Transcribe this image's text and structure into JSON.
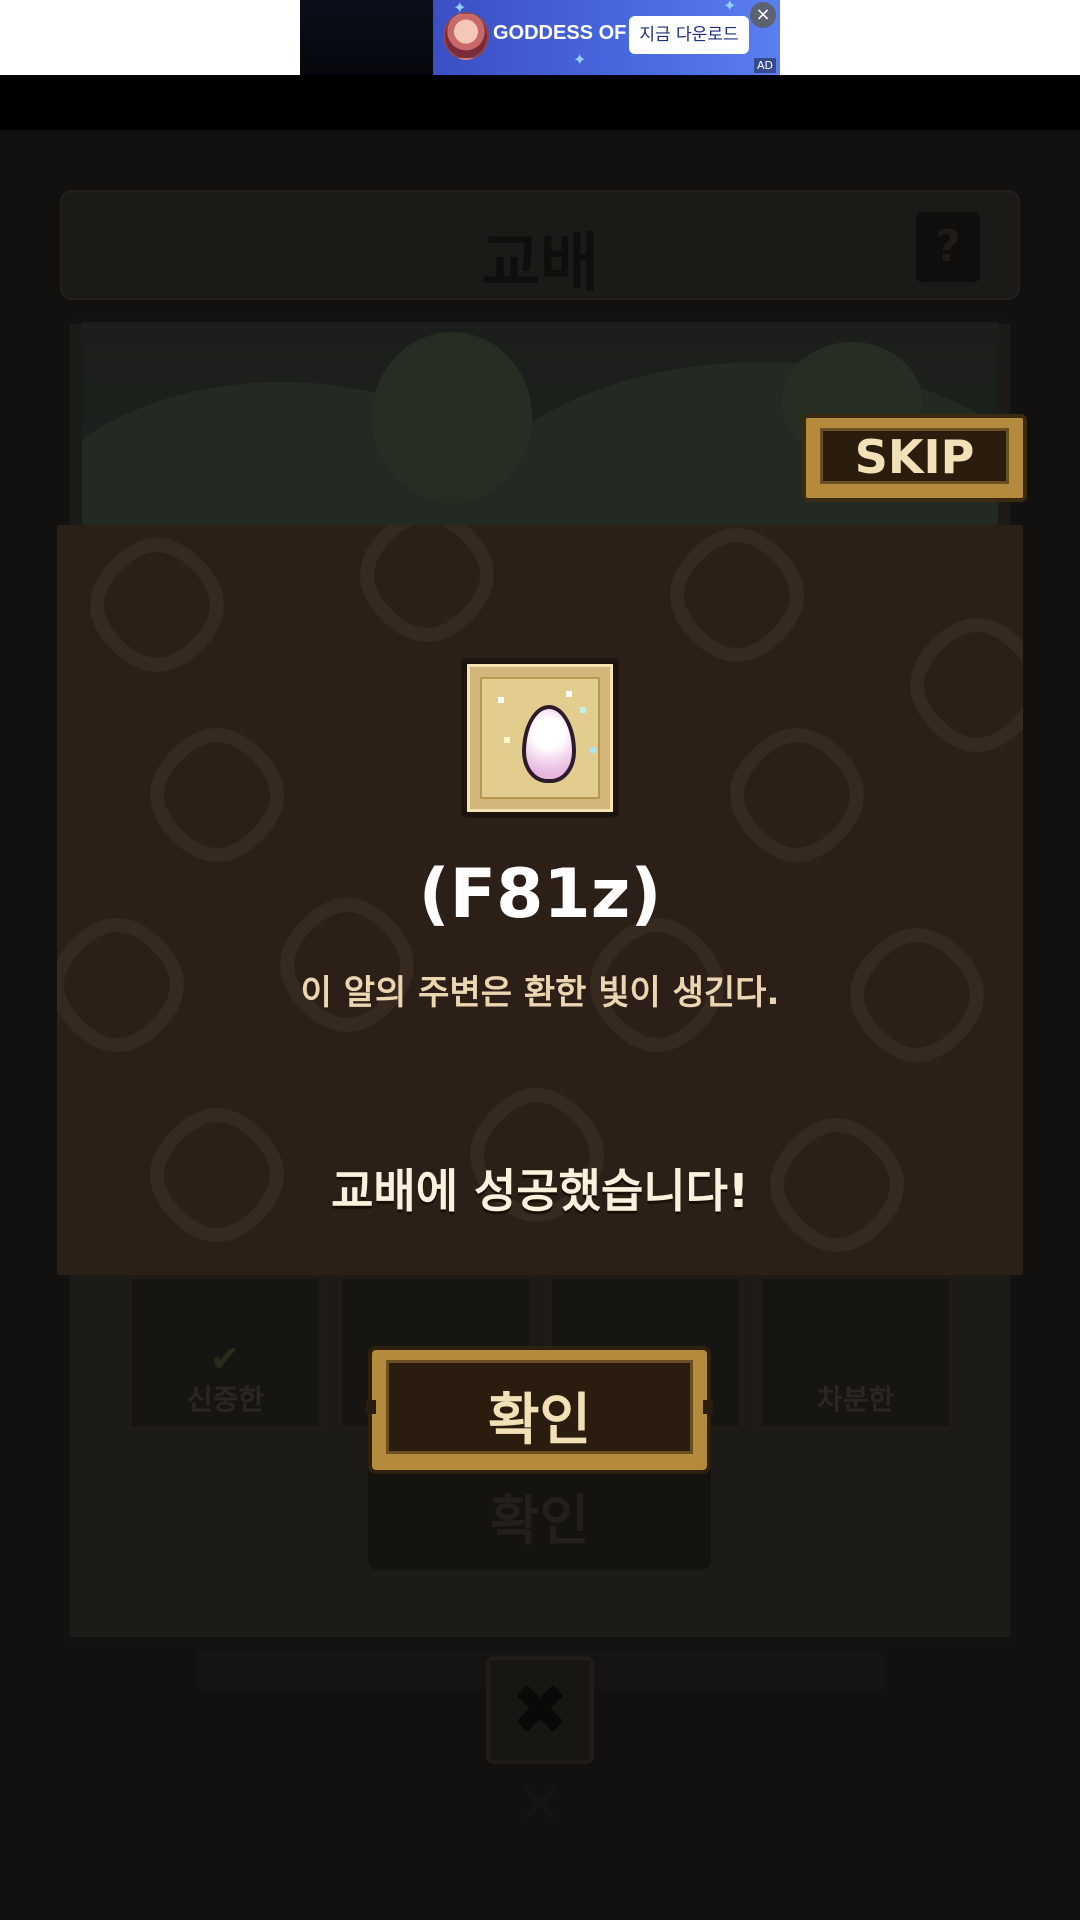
{
  "ad": {
    "title": "GODDESS OF V",
    "cta": "지금 다운로드",
    "badge": "AD",
    "mute_icon": "speaker-muted-icon",
    "close_icon": "close-icon"
  },
  "screen": {
    "header_title": "교배",
    "help_label": "?",
    "skip_label": "SKIP",
    "cards": [
      {
        "label": "신중한"
      },
      {
        "label": ""
      },
      {
        "label": ""
      },
      {
        "label": "차분한"
      }
    ],
    "dim_confirm_label": "확인",
    "close_label": "✖"
  },
  "modal": {
    "egg_icon": "rainbow-egg-icon",
    "egg_name": "(F81z)",
    "egg_description": "이 알의 주변은 환한 빛이 생긴다.",
    "result_message": "교배에 성공했습니다!",
    "confirm_label": "확인"
  },
  "colors": {
    "modal_bg": "#2b1f18",
    "button_gold": "#b48a3c",
    "button_dark": "#2a1c0f",
    "label_cream": "#f2e1b6"
  }
}
